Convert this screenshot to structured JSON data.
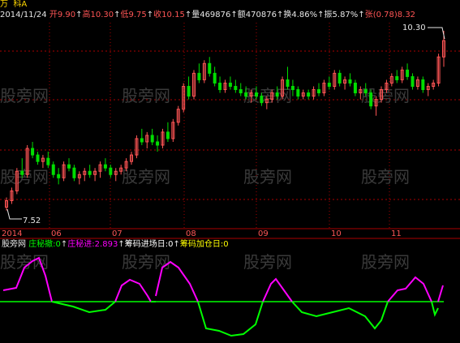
{
  "header": {
    "title_prefix": "万",
    "stock_name": "科A",
    "date": "2014/11/24",
    "open_label": "开",
    "open_value": "9.90",
    "high_label": "高",
    "high_value": "10.30",
    "low_label": "低",
    "low_value": "9.75",
    "close_label": "收",
    "close_value": "10.15",
    "volume_label": "量",
    "volume_value": "469876",
    "amount_label": "额",
    "amount_value": "470876",
    "turnover_label": "换",
    "turnover_value": "4.86%",
    "amplitude_label": "振",
    "amplitude_value": "5.87%",
    "change_label": "张",
    "change_value": "(0.78)8.32"
  },
  "price_annotations": {
    "high_mark": "10.30",
    "low_mark": "7.52"
  },
  "x_axis": {
    "labels": [
      "2014",
      "06",
      "07",
      "08",
      "09",
      "10",
      "11"
    ]
  },
  "watermark": "股旁网",
  "indicator": {
    "name": "股旁网",
    "items": [
      {
        "label": "庄秘撤:0",
        "color": "#00ff00"
      },
      {
        "label": "庄秘进:2.893",
        "color": "#ff00ff"
      },
      {
        "label": "筹码进场日:0",
        "color": "#ffffff"
      },
      {
        "label": "筹码加仓日:0",
        "color": "#ffff00"
      }
    ]
  },
  "colors": {
    "up": "#ff5555",
    "down": "#00dd00",
    "grid": "#aa0000",
    "magenta": "#ff00ff",
    "green": "#00ff00",
    "zero": "#00ff00"
  },
  "chart_data": {
    "type": "candlestick",
    "y_range": [
      7.52,
      10.3
    ],
    "ohlc": [
      [
        7.6,
        7.75,
        7.55,
        7.7
      ],
      [
        7.7,
        7.9,
        7.65,
        7.85
      ],
      [
        7.85,
        8.2,
        7.8,
        8.15
      ],
      [
        8.15,
        8.35,
        8.05,
        8.1
      ],
      [
        8.1,
        8.55,
        8.05,
        8.5
      ],
      [
        8.5,
        8.6,
        8.35,
        8.4
      ],
      [
        8.4,
        8.45,
        8.25,
        8.3
      ],
      [
        8.3,
        8.4,
        8.2,
        8.35
      ],
      [
        8.35,
        8.45,
        8.2,
        8.25
      ],
      [
        8.25,
        8.3,
        8.05,
        8.1
      ],
      [
        8.1,
        8.2,
        7.95,
        8.05
      ],
      [
        8.05,
        8.3,
        8.0,
        8.25
      ],
      [
        8.25,
        8.35,
        8.15,
        8.2
      ],
      [
        8.2,
        8.25,
        8.0,
        8.05
      ],
      [
        8.05,
        8.15,
        7.95,
        8.1
      ],
      [
        8.1,
        8.2,
        8.0,
        8.15
      ],
      [
        8.15,
        8.25,
        8.05,
        8.1
      ],
      [
        8.1,
        8.2,
        8.0,
        8.15
      ],
      [
        8.15,
        8.3,
        8.05,
        8.25
      ],
      [
        8.25,
        8.35,
        8.15,
        8.2
      ],
      [
        8.2,
        8.25,
        8.05,
        8.1
      ],
      [
        8.1,
        8.2,
        8.0,
        8.15
      ],
      [
        8.15,
        8.25,
        8.1,
        8.2
      ],
      [
        8.2,
        8.35,
        8.15,
        8.3
      ],
      [
        8.3,
        8.45,
        8.25,
        8.4
      ],
      [
        8.4,
        8.7,
        8.35,
        8.65
      ],
      [
        8.65,
        8.8,
        8.55,
        8.6
      ],
      [
        8.6,
        8.75,
        8.5,
        8.7
      ],
      [
        8.7,
        8.8,
        8.55,
        8.6
      ],
      [
        8.6,
        8.7,
        8.45,
        8.55
      ],
      [
        8.55,
        8.8,
        8.5,
        8.75
      ],
      [
        8.75,
        8.9,
        8.6,
        8.65
      ],
      [
        8.65,
        8.95,
        8.6,
        8.9
      ],
      [
        8.9,
        9.15,
        8.85,
        9.1
      ],
      [
        9.1,
        9.5,
        9.05,
        9.45
      ],
      [
        9.45,
        9.6,
        9.25,
        9.3
      ],
      [
        9.3,
        9.7,
        9.25,
        9.65
      ],
      [
        9.65,
        9.8,
        9.5,
        9.55
      ],
      [
        9.55,
        9.85,
        9.5,
        9.8
      ],
      [
        9.8,
        9.9,
        9.6,
        9.65
      ],
      [
        9.65,
        9.75,
        9.45,
        9.5
      ],
      [
        9.5,
        9.6,
        9.35,
        9.4
      ],
      [
        9.4,
        9.55,
        9.35,
        9.5
      ],
      [
        9.5,
        9.6,
        9.4,
        9.45
      ],
      [
        9.45,
        9.55,
        9.35,
        9.4
      ],
      [
        9.4,
        9.5,
        9.3,
        9.35
      ],
      [
        9.35,
        9.45,
        9.25,
        9.3
      ],
      [
        9.3,
        9.4,
        9.2,
        9.35
      ],
      [
        9.35,
        9.45,
        9.25,
        9.3
      ],
      [
        9.3,
        9.35,
        9.15,
        9.2
      ],
      [
        9.2,
        9.3,
        9.1,
        9.25
      ],
      [
        9.25,
        9.4,
        9.2,
        9.35
      ],
      [
        9.35,
        9.45,
        9.25,
        9.3
      ],
      [
        9.3,
        9.6,
        9.25,
        9.55
      ],
      [
        9.55,
        9.75,
        9.4,
        9.45
      ],
      [
        9.45,
        9.55,
        9.3,
        9.4
      ],
      [
        9.4,
        9.45,
        9.25,
        9.3
      ],
      [
        9.3,
        9.4,
        9.25,
        9.35
      ],
      [
        9.35,
        9.4,
        9.25,
        9.3
      ],
      [
        9.3,
        9.45,
        9.25,
        9.4
      ],
      [
        9.4,
        9.5,
        9.3,
        9.35
      ],
      [
        9.35,
        9.55,
        9.3,
        9.5
      ],
      [
        9.5,
        9.6,
        9.4,
        9.45
      ],
      [
        9.45,
        9.7,
        9.4,
        9.65
      ],
      [
        9.65,
        9.7,
        9.45,
        9.5
      ],
      [
        9.5,
        9.6,
        9.4,
        9.55
      ],
      [
        9.55,
        9.65,
        9.45,
        9.5
      ],
      [
        9.5,
        9.55,
        9.3,
        9.35
      ],
      [
        9.35,
        9.45,
        9.25,
        9.4
      ],
      [
        9.4,
        9.5,
        9.3,
        9.35
      ],
      [
        9.35,
        9.4,
        9.1,
        9.15
      ],
      [
        9.15,
        9.3,
        9.0,
        9.25
      ],
      [
        9.25,
        9.45,
        9.2,
        9.4
      ],
      [
        9.4,
        9.55,
        9.35,
        9.5
      ],
      [
        9.5,
        9.65,
        9.45,
        9.6
      ],
      [
        9.6,
        9.7,
        9.5,
        9.55
      ],
      [
        9.55,
        9.75,
        9.5,
        9.7
      ],
      [
        9.7,
        9.8,
        9.55,
        9.6
      ],
      [
        9.6,
        9.65,
        9.4,
        9.45
      ],
      [
        9.45,
        9.6,
        9.4,
        9.55
      ],
      [
        9.55,
        9.6,
        9.35,
        9.4
      ],
      [
        9.4,
        9.5,
        9.3,
        9.45
      ],
      [
        9.45,
        9.55,
        9.4,
        9.5
      ],
      [
        9.5,
        9.95,
        9.45,
        9.9
      ],
      [
        9.9,
        10.3,
        9.75,
        10.15
      ]
    ]
  }
}
